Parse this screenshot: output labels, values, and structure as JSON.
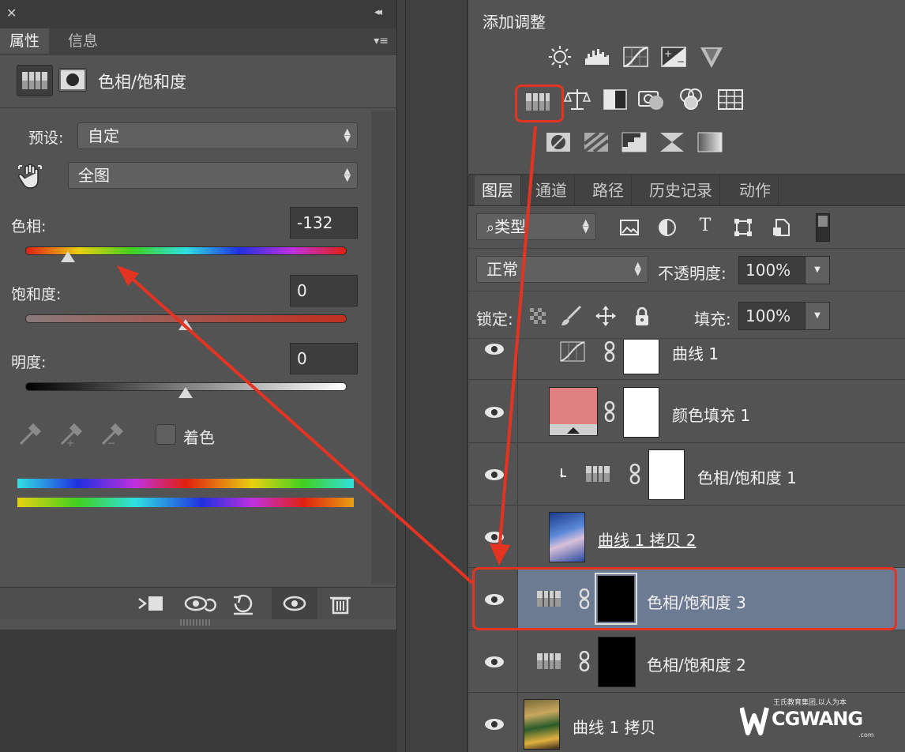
{
  "properties": {
    "close_glyph": "✕",
    "collapse_glyph": "◂◂",
    "tabs": [
      "属性",
      "信息"
    ],
    "menu_glyph": "▾≡",
    "title": "色相/饱和度",
    "preset_label": "预设:",
    "preset_value": "自定",
    "range_value": "全图",
    "hue_label": "色相:",
    "hue_value": "-132",
    "hue_level": 0.133,
    "saturation_label": "饱和度:",
    "saturation_value": "0",
    "saturation_level": 0.5,
    "lightness_label": "明度:",
    "lightness_value": "0",
    "lightness_level": 0.5,
    "colorize_label": "着色",
    "colorize_checked": false
  },
  "adjustments": {
    "title": "添加调整",
    "icons_row1": [
      "brightness-icon",
      "levels-icon",
      "curves-icon",
      "exposure-icon",
      "gradient-map-triangle-icon"
    ],
    "icons_row2": [
      "hue-saturation-icon",
      "color-balance-icon",
      "black-white-icon",
      "photo-filter-icon",
      "channel-mixer-icon",
      "color-lookup-icon"
    ],
    "icons_row3": [
      "invert-icon",
      "posterize-icon",
      "threshold-icon",
      "selective-color-icon",
      "gradient-map-icon"
    ],
    "highlighted": "hue-saturation-icon"
  },
  "layers": {
    "tabs": [
      "图层",
      "通道",
      "路径",
      "历史记录",
      "动作"
    ],
    "filter_label": "类型",
    "blend_mode": "正常",
    "opacity_label": "不透明度:",
    "opacity_value": "100%",
    "lock_label": "锁定:",
    "fill_label": "填充:",
    "fill_value": "100%",
    "items": [
      {
        "name": "曲线 1",
        "type": "curves"
      },
      {
        "name": "颜色填充 1",
        "type": "color-fill"
      },
      {
        "name": "色相/饱和度 1",
        "type": "hue-sat-clipped"
      },
      {
        "name": "曲线 1 拷贝 2",
        "type": "photo"
      },
      {
        "name": "色相/饱和度 3",
        "type": "hue-sat-selected"
      },
      {
        "name": "色相/饱和度 2",
        "type": "hue-sat"
      },
      {
        "name": "曲线 1 拷贝",
        "type": "photo2"
      }
    ]
  },
  "watermark": {
    "brand": "CGWANG",
    "tagline": "王氏教育集团,以人为本",
    "suffix": ".com"
  },
  "colors": {
    "highlight_red": "#e53322",
    "selected_row": "#6d7b92",
    "fill_swatch": "#e08080"
  }
}
